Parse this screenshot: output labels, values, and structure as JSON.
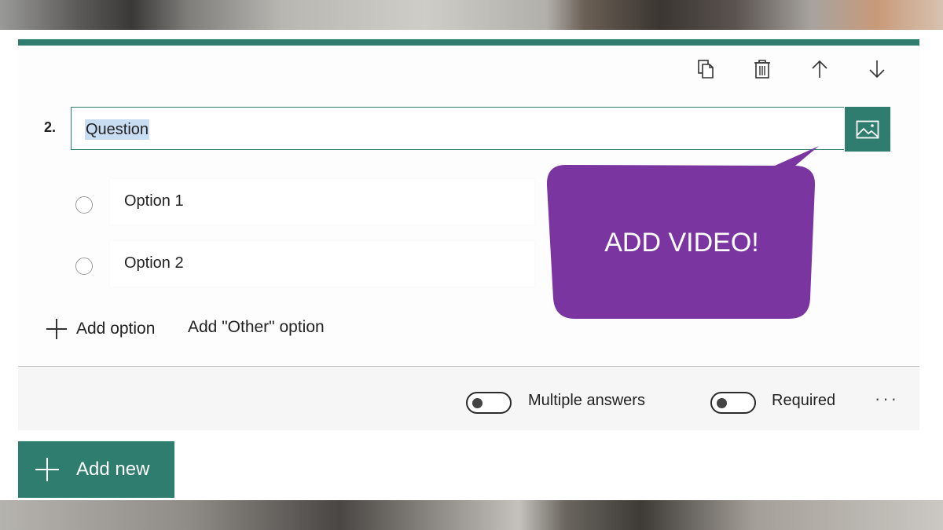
{
  "question": {
    "number": "2.",
    "text": "Question"
  },
  "options": [
    {
      "label": "Option 1"
    },
    {
      "label": "Option 2"
    }
  ],
  "add_option_label": "Add option",
  "add_other_label": "Add \"Other\" option",
  "footer": {
    "multiple_answers_label": "Multiple answers",
    "multiple_answers_on": false,
    "required_label": "Required",
    "required_on": false,
    "more_label": "···"
  },
  "add_new_label": "Add new",
  "callout_text": "ADD VIDEO!",
  "colors": {
    "accent": "#2e7d6f",
    "callout": "#7a35a0"
  },
  "toolbar_icons": [
    "copy-icon",
    "delete-icon",
    "move-up-icon",
    "move-down-icon"
  ]
}
